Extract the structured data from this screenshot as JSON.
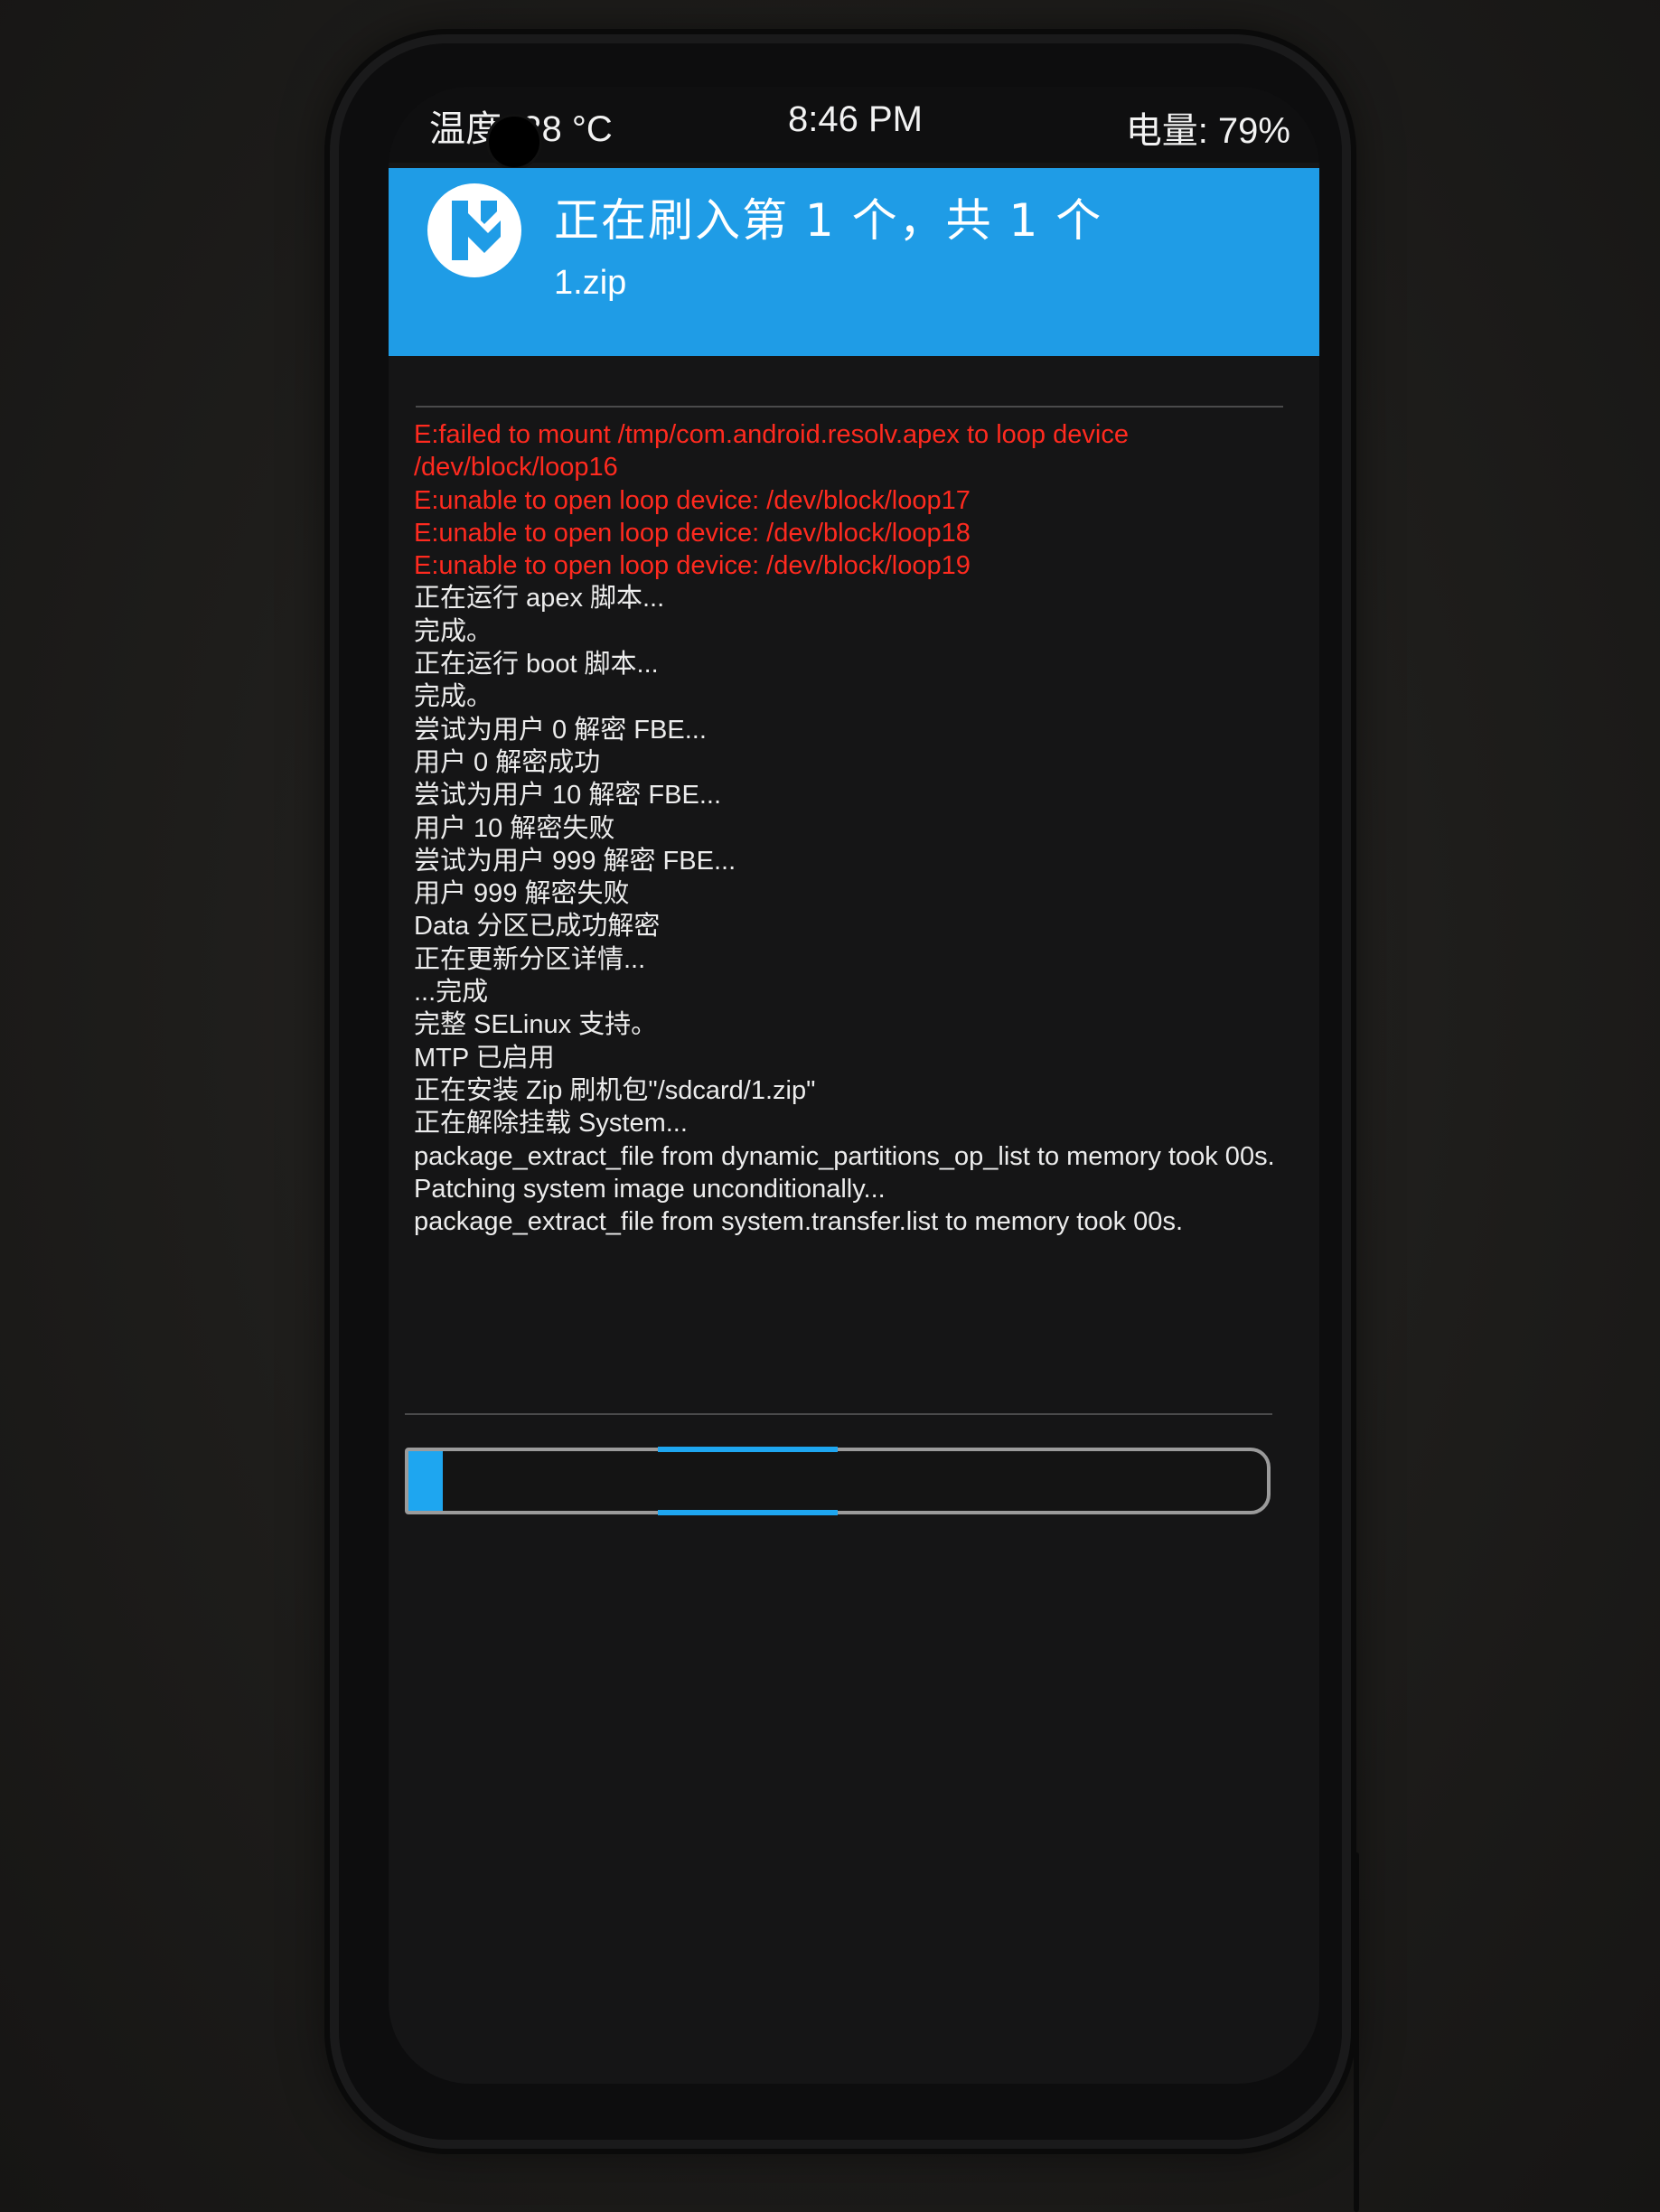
{
  "status_bar": {
    "temperature": "温度: 38 °C",
    "time": "8:46 PM",
    "battery": "电量: 79%"
  },
  "header": {
    "logo_icon": "twrp-logo-icon",
    "title": "正在刷入第 1 个，共 1 个",
    "subtitle": "1.zip",
    "background_color": "#1f9ce6"
  },
  "console": {
    "lines": [
      {
        "text": "E:failed to mount /tmp/com.android.resolv.apex to loop device /dev/block/loop16",
        "type": "error"
      },
      {
        "text": "E:unable to open loop device: /dev/block/loop17",
        "type": "error"
      },
      {
        "text": "E:unable to open loop device: /dev/block/loop18",
        "type": "error"
      },
      {
        "text": "E:unable to open loop device: /dev/block/loop19",
        "type": "error"
      },
      {
        "text": "正在运行 apex 脚本...",
        "type": "info"
      },
      {
        "text": "完成。",
        "type": "info"
      },
      {
        "text": "正在运行 boot 脚本...",
        "type": "info"
      },
      {
        "text": "完成。",
        "type": "info"
      },
      {
        "text": "尝试为用户 0 解密 FBE...",
        "type": "info"
      },
      {
        "text": "用户 0 解密成功",
        "type": "info"
      },
      {
        "text": "尝试为用户 10 解密 FBE...",
        "type": "info"
      },
      {
        "text": "用户 10 解密失败",
        "type": "info"
      },
      {
        "text": "尝试为用户 999 解密 FBE...",
        "type": "info"
      },
      {
        "text": "用户 999 解密失败",
        "type": "info"
      },
      {
        "text": "Data 分区已成功解密",
        "type": "info"
      },
      {
        "text": "正在更新分区详情...",
        "type": "info"
      },
      {
        "text": "...完成",
        "type": "info"
      },
      {
        "text": "完整 SELinux 支持。",
        "type": "info"
      },
      {
        "text": "MTP 已启用",
        "type": "info"
      },
      {
        "text": "正在安装 Zip 刷机包\"/sdcard/1.zip\"",
        "type": "info"
      },
      {
        "text": "正在解除挂载 System...",
        "type": "info"
      },
      {
        "text": "package_extract_file from dynamic_partitions_op_list to memory took 00s.",
        "type": "info"
      },
      {
        "text": "Patching system image unconditionally...",
        "type": "info"
      },
      {
        "text": "package_extract_file from system.transfer.list to memory took 00s.",
        "type": "info"
      }
    ],
    "error_color": "#ff2a1f",
    "info_color": "#ececec"
  },
  "progress": {
    "fraction": 0.04,
    "indeterminate_fraction_start": 0.29,
    "indeterminate_fraction_end": 0.5,
    "color": "#1ea6f0"
  }
}
